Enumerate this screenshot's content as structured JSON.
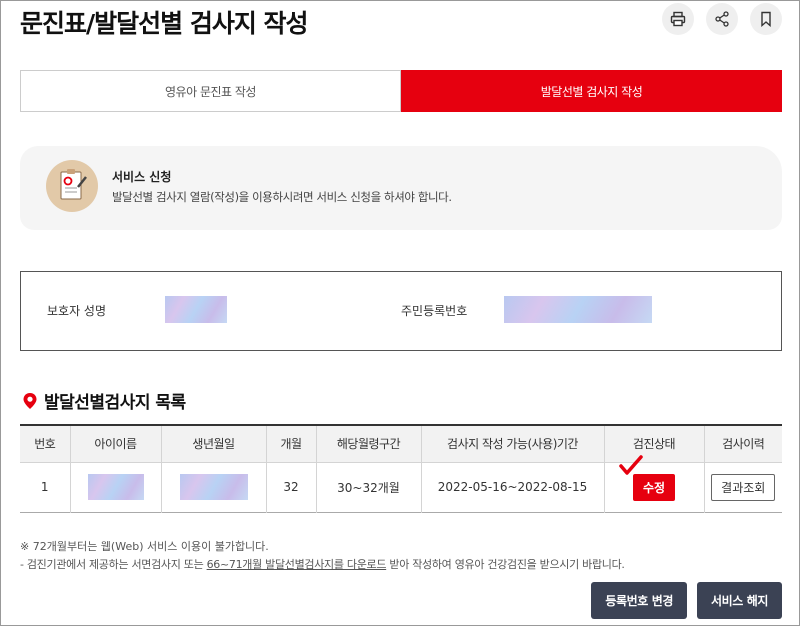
{
  "page": {
    "title": "문진표/발달선별 검사지 작성"
  },
  "toolbar": {
    "icons": [
      "print-icon",
      "share-icon",
      "bookmark-icon"
    ]
  },
  "tabs": [
    {
      "label": "영유아 문진표 작성",
      "active": false
    },
    {
      "label": "발달선별 검사지 작성",
      "active": true
    }
  ],
  "notice": {
    "title": "서비스 신청",
    "description": "발달선별 검사지 열람(작성)을 이용하시려면 서비스 신청을 하셔야 합니다."
  },
  "guardian": {
    "name_label": "보호자 성명",
    "id_label": "주민등록번호"
  },
  "list": {
    "title": "발달선별검사지 목록",
    "headers": [
      "번호",
      "아이이름",
      "생년월일",
      "개월",
      "해당월령구간",
      "검사지 작성 가능(사용)기간",
      "검진상태",
      "검사이력"
    ],
    "rows": [
      {
        "no": "1",
        "months": "32",
        "range": "30~32개월",
        "period": "2022-05-16~2022-08-15",
        "status_button": "수정",
        "history_button": "결과조회"
      }
    ]
  },
  "notes": {
    "line1": "※ 72개월부터는 웹(Web) 서비스 이용이 불가합니다.",
    "line2_pre": "- 검진기관에서 제공하는 서면검사지 또는 ",
    "line2_link": "66~71개월 발달선별검사지를 다운로드",
    "line2_post": " 받아 작성하여 영유아 건강검진을 받으시기 바랍니다."
  },
  "actions": {
    "change_reg": "등록번호 변경",
    "cancel_service": "서비스 해지"
  },
  "colors": {
    "accent": "#e6000f",
    "dark_button": "#3b4254"
  }
}
